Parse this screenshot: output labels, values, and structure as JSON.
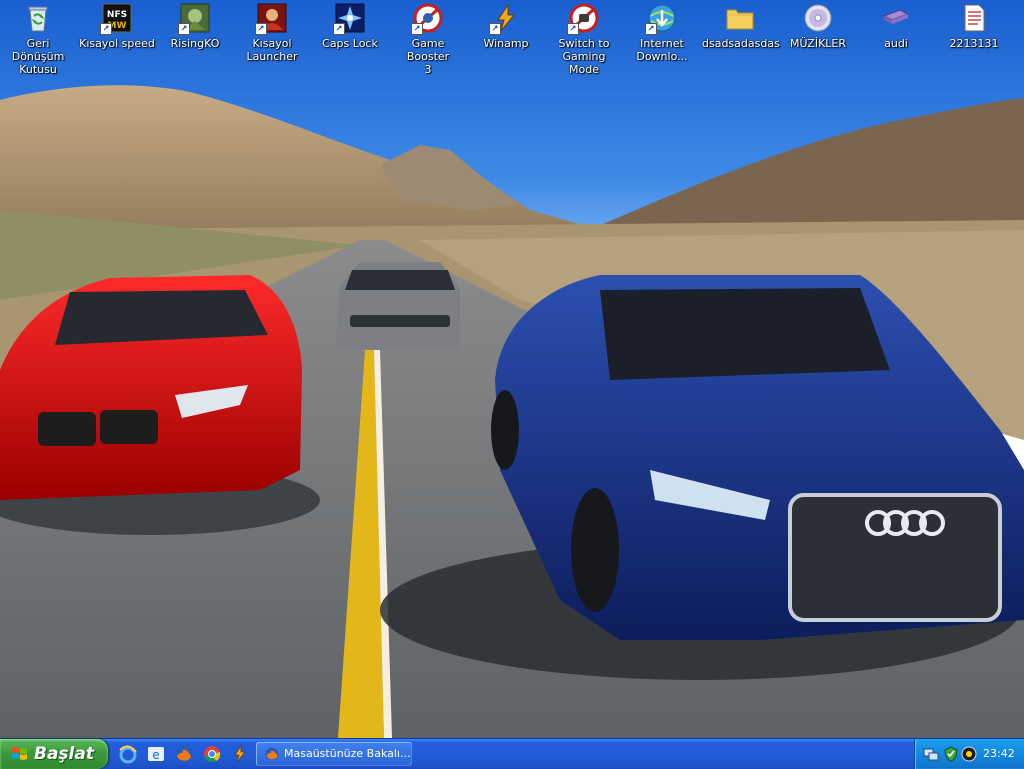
{
  "desktop": {
    "icons": [
      {
        "label": "Geri Dönüşüm\nKutusu",
        "icon": "recycle-bin-icon"
      },
      {
        "label": "Kısayol speed",
        "icon": "nfs-most-wanted-icon"
      },
      {
        "label": "RisingKO",
        "icon": "risingko-game-icon"
      },
      {
        "label": "Kısayol\nLauncher",
        "icon": "launcher-icon"
      },
      {
        "label": "Caps Lock",
        "icon": "caps-lock-icon"
      },
      {
        "label": "Game Booster\n3",
        "icon": "game-booster-icon"
      },
      {
        "label": "Winamp",
        "icon": "winamp-icon"
      },
      {
        "label": "Switch to\nGaming Mode",
        "icon": "gaming-mode-icon"
      },
      {
        "label": "Internet\nDownlo...",
        "icon": "internet-download-manager-icon"
      },
      {
        "label": "dsadsadasdas",
        "icon": "folder-icon"
      },
      {
        "label": "MÜZİKLER",
        "icon": "music-cd-icon"
      },
      {
        "label": "audi",
        "icon": "drive-icon"
      },
      {
        "label": "2213131",
        "icon": "text-document-icon"
      }
    ]
  },
  "taskbar": {
    "start_label": "Başlat",
    "quick_launch": [
      "internet-explorer-icon",
      "ie-alt-icon",
      "firefox-icon",
      "chrome-icon",
      "winamp-icon"
    ],
    "task_button_label": "Masaüstünüze Bakalı...",
    "tray_icons": [
      "network-icon",
      "security-icon",
      "volume-icon"
    ],
    "clock": "23:42"
  },
  "colors": {
    "taskbar": "#245edc",
    "start_button": "#3c9a3c",
    "tray": "#1284dc",
    "sky": "#2a6fd6"
  }
}
